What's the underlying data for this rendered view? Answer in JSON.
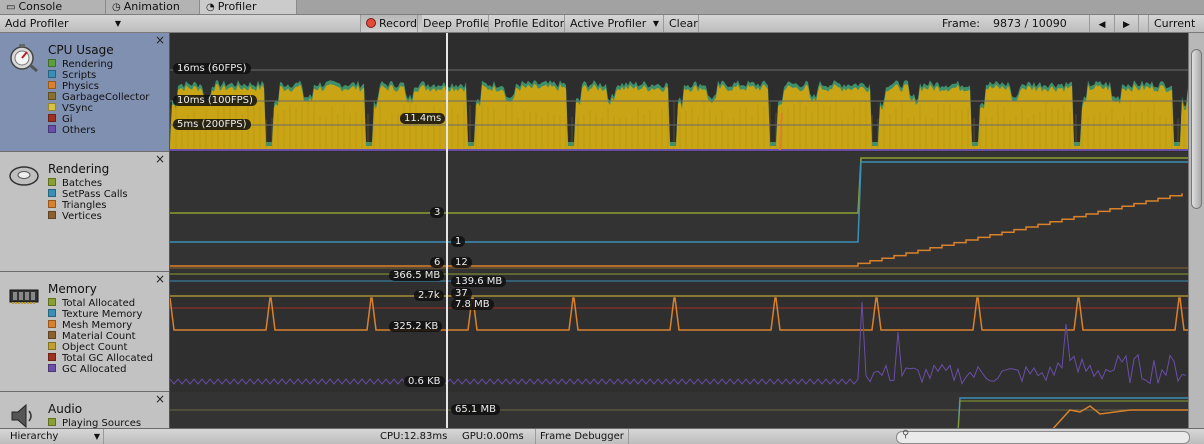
{
  "tabs": [
    {
      "label": "Console",
      "icon": "console-icon"
    },
    {
      "label": "Animation",
      "icon": "animation-icon"
    },
    {
      "label": "Profiler",
      "icon": "profiler-icon",
      "active": true
    }
  ],
  "toolbar": {
    "add_profiler": "Add Profiler",
    "record": "Record",
    "deep_profile": "Deep Profile",
    "profile_editor": "Profile Editor",
    "active_profiler": "Active Profiler",
    "clear": "Clear",
    "frame_label": "Frame:",
    "frame_value": "9873 / 10090",
    "prev_icon": "previous-frame-icon",
    "next_icon": "next-frame-icon",
    "current": "Current"
  },
  "modules": [
    {
      "name": "CPU Usage",
      "icon": "cpu-usage-icon",
      "selected": true,
      "items": [
        {
          "label": "Rendering",
          "color": "#5e9e3c"
        },
        {
          "label": "Scripts",
          "color": "#3a8fb7"
        },
        {
          "label": "Physics",
          "color": "#d9822b"
        },
        {
          "label": "GarbageCollector",
          "color": "#8a7030"
        },
        {
          "label": "VSync",
          "color": "#d8c040"
        },
        {
          "label": "Gi",
          "color": "#a03020"
        },
        {
          "label": "Others",
          "color": "#6a4ea8"
        }
      ]
    },
    {
      "name": "Rendering",
      "icon": "rendering-icon",
      "items": [
        {
          "label": "Batches",
          "color": "#8aa030"
        },
        {
          "label": "SetPass Calls",
          "color": "#3a8fb7"
        },
        {
          "label": "Triangles",
          "color": "#d9822b"
        },
        {
          "label": "Vertices",
          "color": "#8a6030"
        }
      ]
    },
    {
      "name": "Memory",
      "icon": "memory-icon",
      "items": [
        {
          "label": "Total Allocated",
          "color": "#8aa030"
        },
        {
          "label": "Texture Memory",
          "color": "#3a8fb7"
        },
        {
          "label": "Mesh Memory",
          "color": "#d9822b"
        },
        {
          "label": "Material Count",
          "color": "#8a6030"
        },
        {
          "label": "Object Count",
          "color": "#c0a030"
        },
        {
          "label": "Total GC Allocated",
          "color": "#a03020"
        },
        {
          "label": "GC Allocated",
          "color": "#6a4ea8"
        }
      ]
    },
    {
      "name": "Audio",
      "icon": "audio-icon",
      "items": [
        {
          "label": "Playing Sources",
          "color": "#8aa030"
        }
      ]
    }
  ],
  "cpu_chart": {
    "guides": [
      "16ms (60FPS)",
      "10ms (100FPS)",
      "5ms (200FPS)"
    ],
    "selected_value": "11.4ms"
  },
  "rendering_chart": {
    "labels": [
      "3",
      "1",
      "6",
      "12"
    ]
  },
  "memory_chart": {
    "labels": [
      "366.5 MB",
      "139.6 MB",
      "2.7k",
      "37",
      "7.8 MB",
      "325.2 KB",
      "0.6 KB"
    ]
  },
  "audio_chart": {
    "labels": [
      "65.1 MB"
    ]
  },
  "colors": {
    "cpu_fill": "#c9a415",
    "cpu_fill_dark": "#a88810",
    "selection_line": "#e6e6e6",
    "orange": "#d9822b",
    "blue": "#3a8fb7",
    "olive": "#8aa030",
    "purple": "#6a4ea8"
  },
  "bottom": {
    "hierarchy": "Hierarchy",
    "cpu": "CPU:12.83ms",
    "gpu": "GPU:0.00ms",
    "frame_debugger": "Frame Debugger",
    "search_icon": "search-icon"
  }
}
